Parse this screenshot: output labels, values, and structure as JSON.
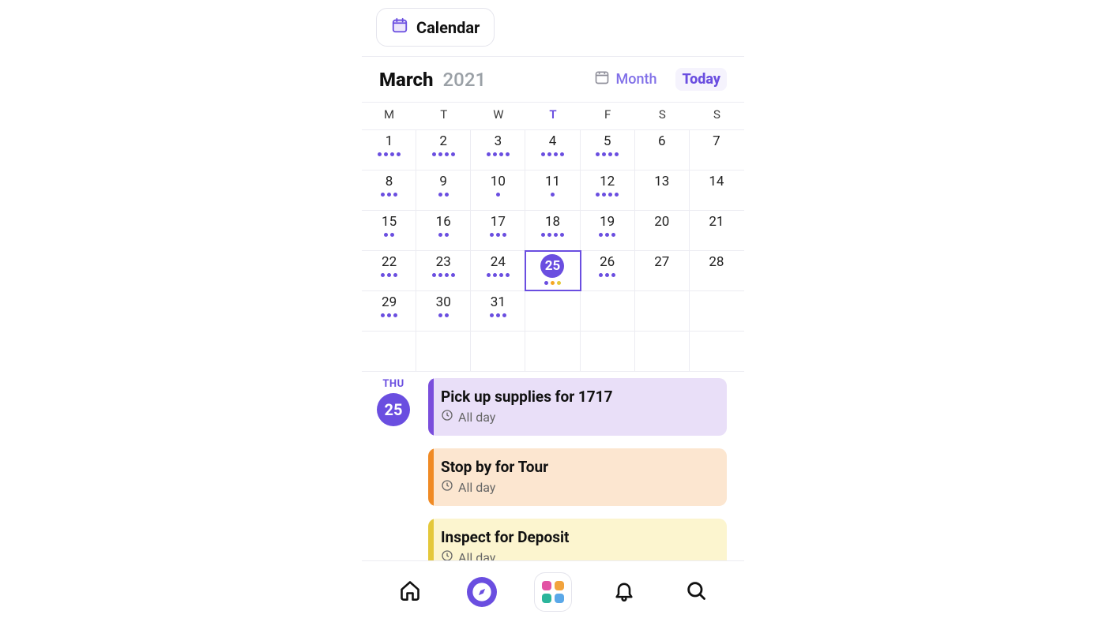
{
  "pill": {
    "label": "Calendar"
  },
  "header": {
    "month": "March",
    "year": "2021",
    "view_label": "Month",
    "today_label": "Today"
  },
  "dow": [
    "M",
    "T",
    "W",
    "T",
    "F",
    "S",
    "S"
  ],
  "today_dow_index": 3,
  "grid": [
    [
      {
        "n": 1,
        "dots": [
          "p",
          "p",
          "p",
          "p"
        ]
      },
      {
        "n": 2,
        "dots": [
          "p",
          "p",
          "p",
          "p"
        ]
      },
      {
        "n": 3,
        "dots": [
          "p",
          "p",
          "p",
          "p"
        ]
      },
      {
        "n": 4,
        "dots": [
          "p",
          "p",
          "p",
          "p"
        ]
      },
      {
        "n": 5,
        "dots": [
          "p",
          "p",
          "p",
          "p"
        ]
      },
      {
        "n": 6,
        "dots": []
      },
      {
        "n": 7,
        "dots": []
      }
    ],
    [
      {
        "n": 8,
        "dots": [
          "p",
          "p",
          "p"
        ]
      },
      {
        "n": 9,
        "dots": [
          "p",
          "p"
        ]
      },
      {
        "n": 10,
        "dots": [
          "p"
        ]
      },
      {
        "n": 11,
        "dots": [
          "p"
        ]
      },
      {
        "n": 12,
        "dots": [
          "p",
          "p",
          "p",
          "p"
        ]
      },
      {
        "n": 13,
        "dots": []
      },
      {
        "n": 14,
        "dots": []
      }
    ],
    [
      {
        "n": 15,
        "dots": [
          "p",
          "p"
        ]
      },
      {
        "n": 16,
        "dots": [
          "p",
          "p"
        ]
      },
      {
        "n": 17,
        "dots": [
          "p",
          "p",
          "p"
        ]
      },
      {
        "n": 18,
        "dots": [
          "p",
          "p",
          "p",
          "p"
        ]
      },
      {
        "n": 19,
        "dots": [
          "p",
          "p",
          "p"
        ]
      },
      {
        "n": 20,
        "dots": []
      },
      {
        "n": 21,
        "dots": []
      }
    ],
    [
      {
        "n": 22,
        "dots": [
          "p",
          "p",
          "p"
        ]
      },
      {
        "n": 23,
        "dots": [
          "p",
          "p",
          "p",
          "p"
        ]
      },
      {
        "n": 24,
        "dots": [
          "p",
          "p",
          "p",
          "p"
        ]
      },
      {
        "n": 25,
        "dots": [
          "p",
          "o",
          "y"
        ],
        "selected": true
      },
      {
        "n": 26,
        "dots": [
          "p",
          "p",
          "p"
        ]
      },
      {
        "n": 27,
        "dots": []
      },
      {
        "n": 28,
        "dots": []
      }
    ],
    [
      {
        "n": 29,
        "dots": [
          "p",
          "p",
          "p"
        ]
      },
      {
        "n": 30,
        "dots": [
          "p",
          "p"
        ]
      },
      {
        "n": 31,
        "dots": [
          "p",
          "p",
          "p"
        ]
      },
      {
        "n": "",
        "dots": []
      },
      {
        "n": "",
        "dots": []
      },
      {
        "n": "",
        "dots": []
      },
      {
        "n": "",
        "dots": []
      }
    ],
    [
      {
        "n": "",
        "dots": []
      },
      {
        "n": "",
        "dots": []
      },
      {
        "n": "",
        "dots": []
      },
      {
        "n": "",
        "dots": []
      },
      {
        "n": "",
        "dots": []
      },
      {
        "n": "",
        "dots": []
      },
      {
        "n": "",
        "dots": []
      }
    ]
  ],
  "selected_day": {
    "dow": "THU",
    "num": "25"
  },
  "events": [
    {
      "title": "Pick up supplies for 1717",
      "time": "All day",
      "color": "purple"
    },
    {
      "title": "Stop by for Tour",
      "time": "All day",
      "color": "orange"
    },
    {
      "title": "Inspect for Deposit",
      "time": "All day",
      "color": "yellow"
    }
  ],
  "nav": {
    "apps_colors": [
      "#e253a4",
      "#f2a33c",
      "#2bb59b",
      "#5aa8e8"
    ]
  }
}
